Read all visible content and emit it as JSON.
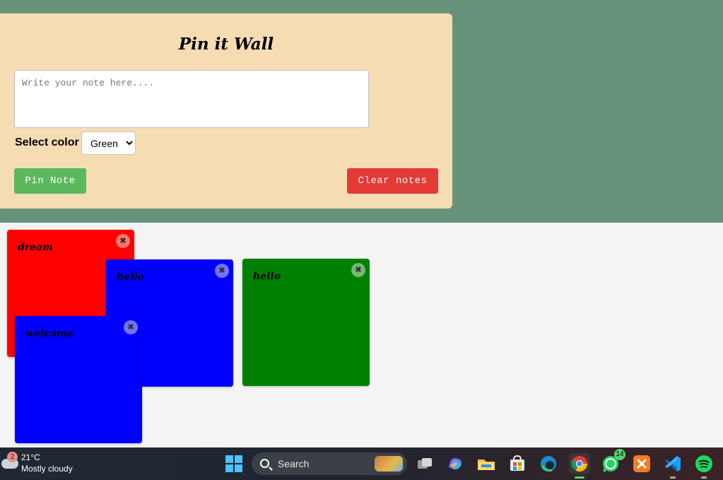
{
  "header": {
    "title": "Pin it Wall",
    "note_placeholder": "Write your note here....",
    "color_label": "Select color",
    "color_selected": "Green",
    "pin_button": "Pin Note",
    "clear_button": "Clear notes"
  },
  "notes": [
    {
      "text": "dream",
      "color": "#ff0000",
      "close_icon": "close-icon",
      "close_glyph": "✖"
    },
    {
      "text": "hello",
      "color": "#0000ff",
      "close_icon": "close-icon",
      "close_glyph": "✖"
    },
    {
      "text": "hello",
      "color": "#008000",
      "close_icon": "close-icon",
      "close_glyph": "✖"
    },
    {
      "text": "welcome",
      "color": "#0000ff",
      "close_icon": "close-icon",
      "close_glyph": "✖"
    }
  ],
  "taskbar": {
    "weather_badge": "2",
    "weather_temp": "21°C",
    "weather_desc": "Mostly cloudy",
    "search_label": "Search",
    "whatsapp_badge": "14"
  },
  "colors": {
    "page_bg": "#67937a",
    "form_bg": "#f5dcb3",
    "wall_bg": "#f4f4f4",
    "pin_button": "#5cb85c",
    "clear_button": "#e53935"
  }
}
